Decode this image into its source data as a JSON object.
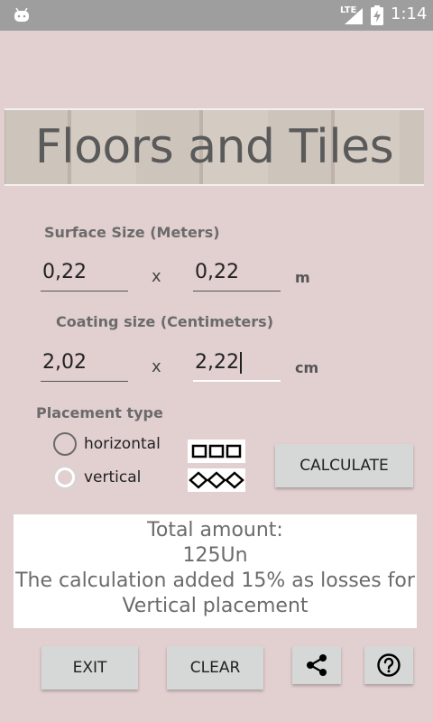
{
  "status_bar": {
    "network": "LTE",
    "time": "1:14"
  },
  "banner": {
    "title": "Floors and Tiles"
  },
  "surface": {
    "label": "Surface Size (Meters)",
    "width": "0,22",
    "height": "0,22",
    "separator": "x",
    "unit": "m"
  },
  "coating": {
    "label": "Coating size (Centimeters)",
    "width": "2,02",
    "height": "2,22",
    "separator": "x",
    "unit": "cm"
  },
  "placement": {
    "label": "Placement type",
    "options": [
      {
        "label": "horizontal",
        "checked": false
      },
      {
        "label": "vertical",
        "checked": true
      }
    ]
  },
  "buttons": {
    "calculate": "CALCULATE",
    "exit": "EXIT",
    "clear": "CLEAR"
  },
  "icons": {
    "share": "share-icon",
    "help": "help-icon"
  },
  "result": {
    "line1": "Total amount:",
    "line2": "125Un",
    "line3": "The calculation added 15% as losses for",
    "line4": "Vertical placement"
  },
  "colors": {
    "background": "#e2cfd0",
    "status_bar": "#9e9e9e",
    "button": "#d6d7d7"
  }
}
